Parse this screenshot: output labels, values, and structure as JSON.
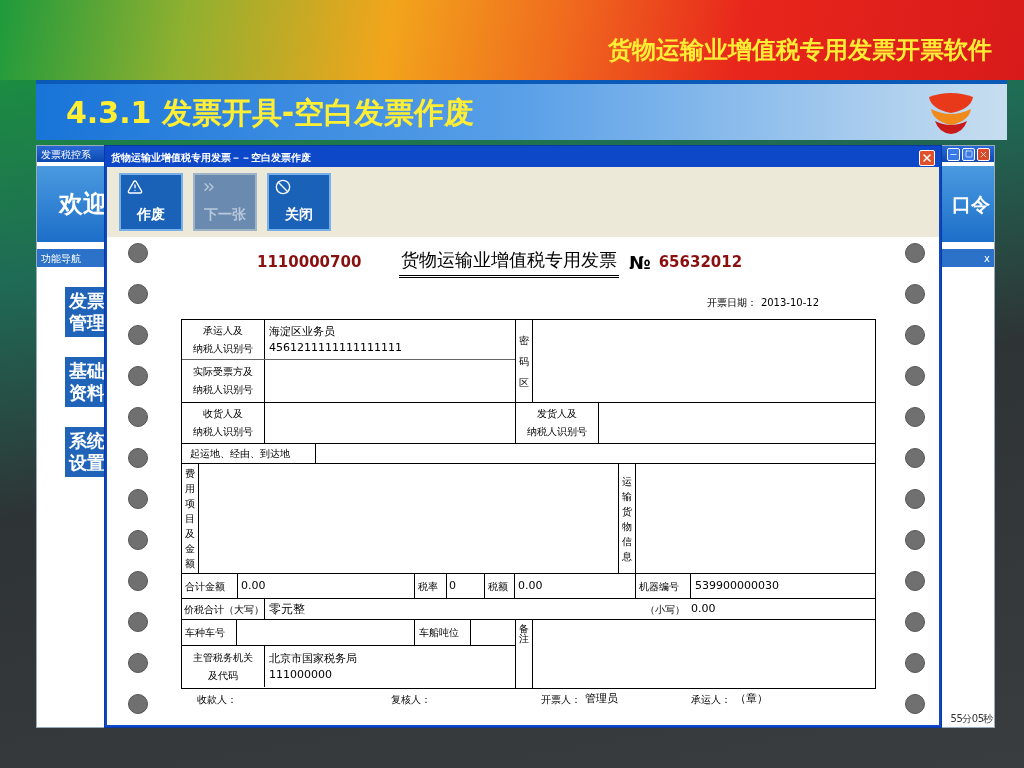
{
  "slide": {
    "header": "货物运输业增值税专用发票开票软件",
    "section_title": "4.3.1 发票开具-空白发票作废"
  },
  "main_window": {
    "title": "发票税控系",
    "banner_left": "欢迎",
    "banner_right": "口令",
    "nav_title": "功能导航",
    "nav_close": "x",
    "status_time": "55分05秒",
    "nav_items": [
      {
        "lines": [
          "发票",
          "管理"
        ]
      },
      {
        "lines": [
          "基础",
          "资料"
        ]
      },
      {
        "lines": [
          "系统",
          "设置"
        ]
      }
    ]
  },
  "dialog": {
    "title": "货物运输业增值税专用发票－－空白发票作废",
    "toolbar": [
      {
        "label": "作废",
        "disabled": false
      },
      {
        "label": "下一张",
        "disabled": true
      },
      {
        "label": "关闭",
        "disabled": false
      }
    ],
    "invoice": {
      "code": "1110000700",
      "title": "货物运输业增值税专用发票",
      "number_sign": "№",
      "number": "65632012",
      "date_label": "开票日期：",
      "date": "2013-10-12",
      "carrier": {
        "label": [
          "承运人及",
          "纳税人识别号"
        ],
        "lines": [
          "海淀区业务员",
          "4561211111111111111"
        ]
      },
      "actual_payer": {
        "label": [
          "实际受票方及",
          "纳税人识别号"
        ]
      },
      "cipher_label": "密码区",
      "consignee": {
        "label": [
          "收货人及",
          "纳税人识别号"
        ]
      },
      "consignor": {
        "label": [
          "发货人及",
          "纳税人识别号"
        ]
      },
      "route_label": "起运地、经由、到达地",
      "fee_label": "费用项目及金额",
      "cargo_label": "运输货物信息",
      "total_label": "合计金额",
      "total": "0.00",
      "rate_label": "税率",
      "rate": "0",
      "tax_label": "税额",
      "tax": "0.00",
      "machine_label": "机器编号",
      "machine_no": "539900000030",
      "sum_label": "价税合计（大写）",
      "sum_upper": "零元整",
      "sum_small_label": "（小写）",
      "sum_small": "0.00",
      "vehicle_label": "车种车号",
      "tonnage_label": "车船吨位",
      "authority": {
        "label": [
          "主管税务机关",
          "及代码"
        ],
        "lines": [
          "北京市国家税务局",
          "111000000"
        ]
      },
      "remarks_label": "备注",
      "footer": [
        {
          "label": "收款人："
        },
        {
          "label": "复核人："
        },
        {
          "label": "开票人：",
          "value": "管理员"
        },
        {
          "label": "承运人：",
          "value": "（章）"
        }
      ]
    }
  }
}
